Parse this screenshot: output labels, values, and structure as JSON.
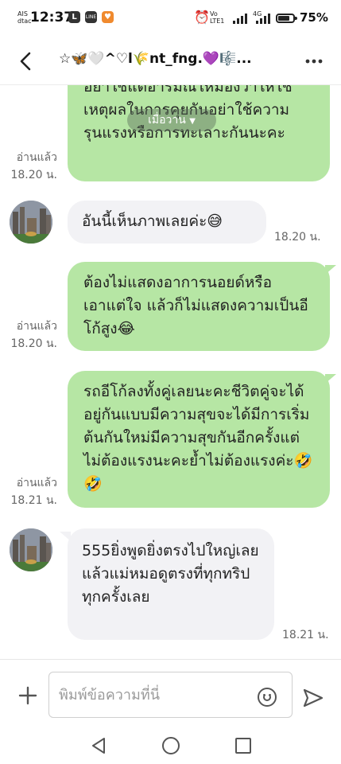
{
  "status_bar": {
    "carrier_line1": "AIS",
    "carrier_line2": "dtac",
    "time": "12:37",
    "app_icon_l": "L",
    "app_icon_line": "LINE",
    "volte_line1": "Vo",
    "volte_line2": "LTE1",
    "network_line1": "4G",
    "battery": "75%",
    "battery_level": 0.75
  },
  "header": {
    "title": "☆🦋🤍^♡l🌾nt_fng.💜🎼...",
    "back_icon": "chevron-left-icon",
    "more_icon": "more-dots-icon"
  },
  "date_separator": "เมื่อวาน",
  "messages": [
    {
      "direction": "out",
      "text": "อย่าใช้แต่อารมณ์ให้มองว่าให้ใช้เหตุผลในการคุยกันอย่าใช้ความรุนแรงหรือการทะเลาะกันนะคะ",
      "read": "อ่านแล้ว",
      "time": "18.20 น."
    },
    {
      "direction": "in",
      "text": "อันนี้เห็นภาพเลยค่ะ😅",
      "time": "18.20 น."
    },
    {
      "direction": "out",
      "text": "ต้องไม่แสดงอาการนอยด์หรือเอาแต่ใจ แล้วก็ไม่แสดงความเป็นอีโก้สูง😂",
      "read": "อ่านแล้ว",
      "time": "18.20 น."
    },
    {
      "direction": "out",
      "text": "รถอีโก้ลงทั้งคู่เลยนะคะชีวิตคู่จะได้อยู่กันแบบมีความสุขจะได้มีการเริ่มต้นกันใหม่มีความสุขกันอีกครั้งแต่ไม่ต้องแรงนะคะย้ำไม่ต้องแรงค่ะ🤣🤣",
      "read": "อ่านแล้ว",
      "time": "18.21 น."
    },
    {
      "direction": "in",
      "text": "555ยิ่งพูดยิ่งตรงไปใหญ่เลย แล้วแม่หมอดูตรงที่ทุกทริปทุกครั้งเลย",
      "time": "18.21 น."
    }
  ],
  "input": {
    "placeholder": "พิมพ์ข้อความที่นี่",
    "value": ""
  },
  "colors": {
    "outgoing_bubble": "#b6e6a4",
    "incoming_bubble": "#f2f2f5",
    "battery_icon_bg": "#f08a2e"
  }
}
